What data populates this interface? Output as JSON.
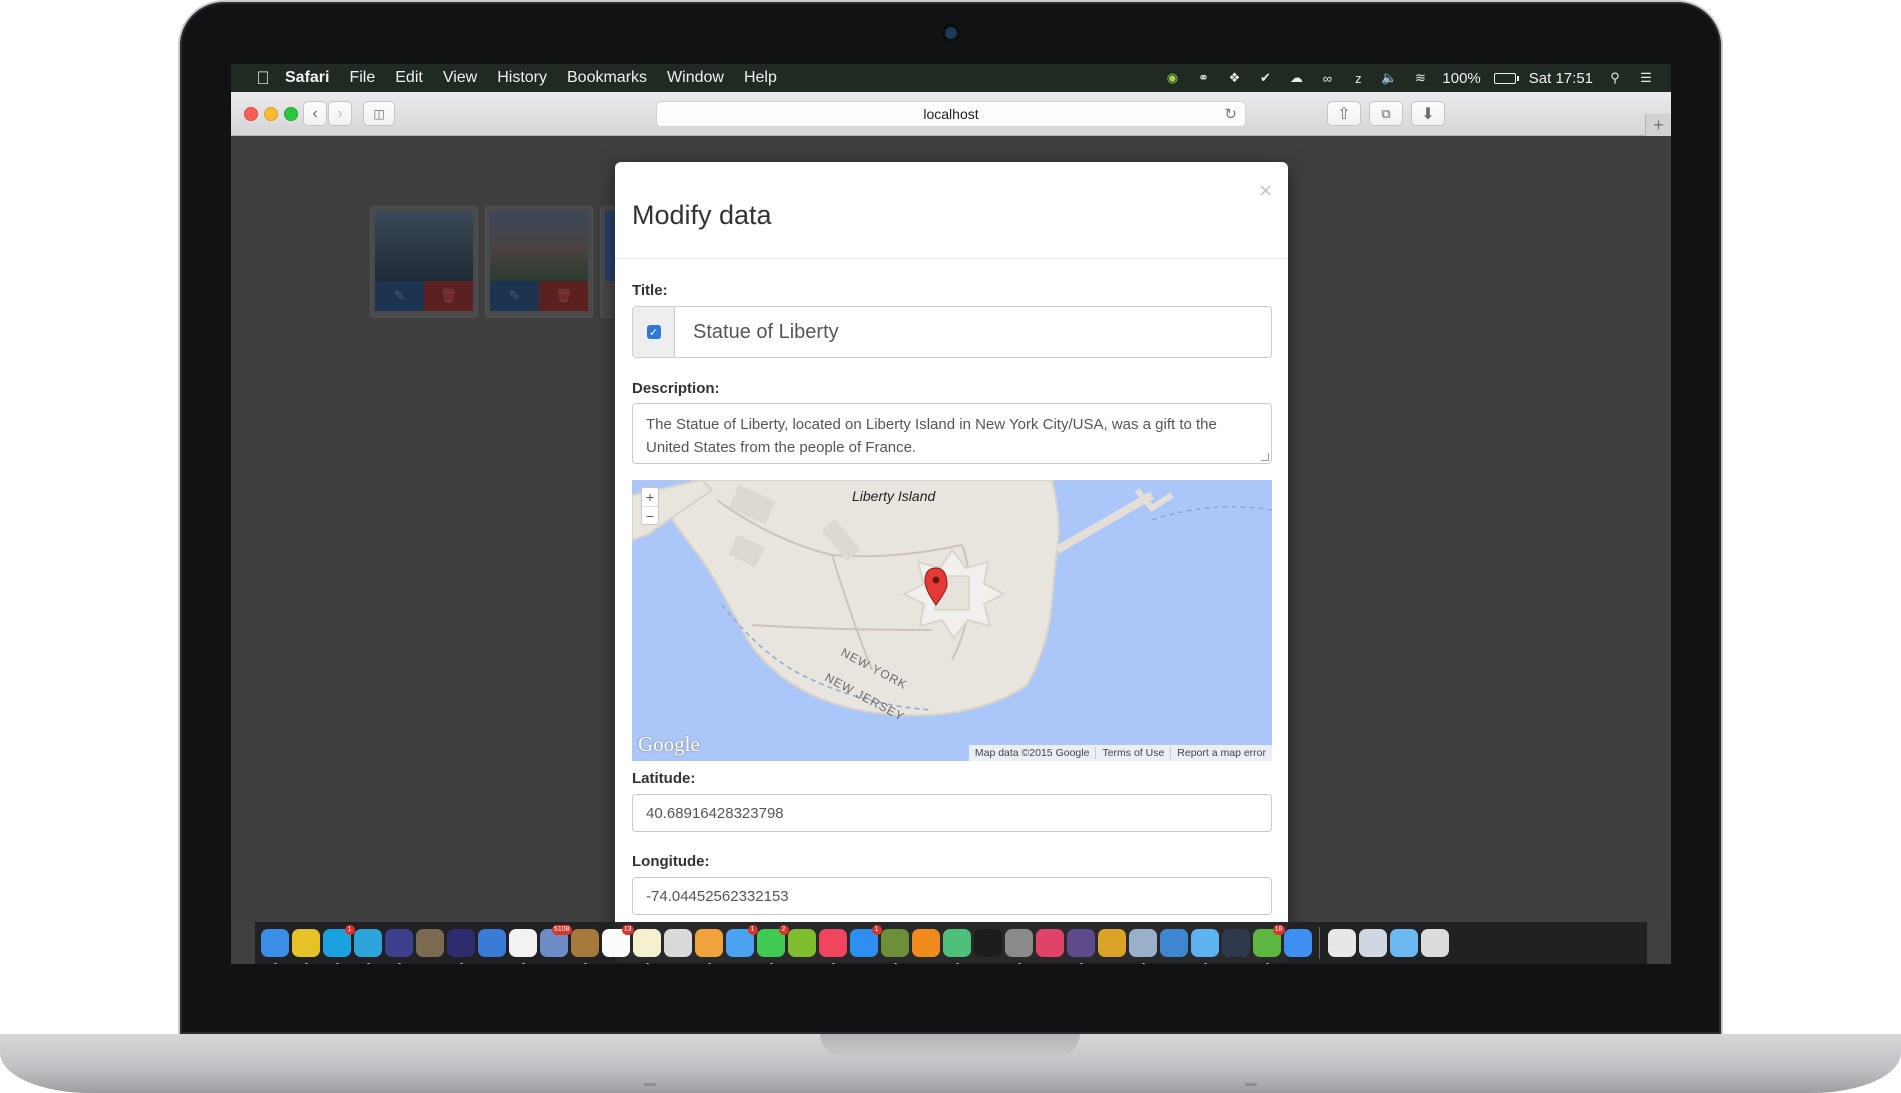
{
  "menubar": {
    "app_name": "Safari",
    "items": [
      "File",
      "Edit",
      "View",
      "History",
      "Bookmarks",
      "Window",
      "Help"
    ],
    "battery": "100%",
    "clock": "Sat 17:51"
  },
  "browser": {
    "url": "localhost"
  },
  "modal": {
    "title": "Modify data",
    "close_symbol": "×",
    "title_label": "Title:",
    "title_value": "Statue of Liberty",
    "description_label": "Description:",
    "description_value": "The Statue of Liberty, located on Liberty Island in New York City/USA, was a gift to the United States from the people of France.",
    "map": {
      "island_label": "Liberty Island",
      "state_label_ny": "NEW YORK",
      "state_label_nj": "NEW JERSEY",
      "logo": "Google",
      "attribution": "Map data ©2015 Google",
      "terms": "Terms of Use",
      "report": "Report a map error",
      "zoom_in": "+",
      "zoom_out": "−"
    },
    "latitude_label": "Latitude:",
    "latitude_value": "40.68916428323798",
    "longitude_label": "Longitude:",
    "longitude_value": "-74.04452562332153"
  },
  "dock": {
    "badges": [
      "1",
      "5108",
      "13",
      "1",
      "2",
      "1",
      "18"
    ],
    "apps": [
      {
        "name": "finder",
        "color": "#3a8ee6"
      },
      {
        "name": "chrome",
        "color": "#e6c229"
      },
      {
        "name": "skype",
        "color": "#1aa1e0"
      },
      {
        "name": "telegram",
        "color": "#2fa3db"
      },
      {
        "name": "eclipse",
        "color": "#3b3f8c"
      },
      {
        "name": "gimp",
        "color": "#7a6a52"
      },
      {
        "name": "eclipse-ide",
        "color": "#2e2c6e"
      },
      {
        "name": "intellij",
        "color": "#3a7bd5"
      },
      {
        "name": "text-file",
        "color": "#f2f2f2"
      },
      {
        "name": "preview",
        "color": "#6b8cc7"
      },
      {
        "name": "notes-book",
        "color": "#a57a3a"
      },
      {
        "name": "calendar",
        "color": "#fbfbfb"
      },
      {
        "name": "stickies",
        "color": "#f4f1d0"
      },
      {
        "name": "preview-2",
        "color": "#d9d9d9"
      },
      {
        "name": "photos",
        "color": "#f0a33c"
      },
      {
        "name": "messages",
        "color": "#4aa3f0"
      },
      {
        "name": "facetime",
        "color": "#3fcb52"
      },
      {
        "name": "spotify",
        "color": "#7dbd2e"
      },
      {
        "name": "itunes",
        "color": "#f0445f"
      },
      {
        "name": "app-store",
        "color": "#2f8ff0"
      },
      {
        "name": "minecraft",
        "color": "#6b8f3a"
      },
      {
        "name": "vlc",
        "color": "#f08a1c"
      },
      {
        "name": "atom",
        "color": "#4fbf7c"
      },
      {
        "name": "terminal",
        "color": "#1d1d1d"
      },
      {
        "name": "system-preferences",
        "color": "#8a8a8a"
      },
      {
        "name": "slack",
        "color": "#e0436a"
      },
      {
        "name": "github",
        "color": "#5e4a8a"
      },
      {
        "name": "cyberduck",
        "color": "#d9a427"
      },
      {
        "name": "network",
        "color": "#9ab0c8"
      },
      {
        "name": "keynote",
        "color": "#3f86d1"
      },
      {
        "name": "xcode",
        "color": "#5cb3f0"
      },
      {
        "name": "sourcetree",
        "color": "#2e3a4c"
      },
      {
        "name": "utorrent",
        "color": "#5db640"
      },
      {
        "name": "safari",
        "color": "#3d8ff2"
      }
    ],
    "stack_items": [
      {
        "name": "jar-file",
        "color": "#e7e7e7"
      },
      {
        "name": "window-stack",
        "color": "#cfd7e2"
      },
      {
        "name": "folder",
        "color": "#6cb9ef"
      },
      {
        "name": "trash",
        "color": "#dcdcdc"
      }
    ]
  }
}
